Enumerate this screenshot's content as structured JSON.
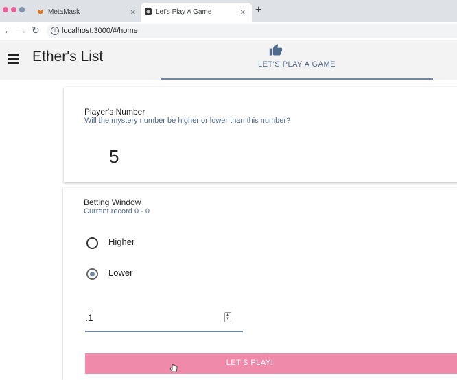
{
  "browser": {
    "tabs": [
      {
        "title": "MetaMask",
        "active": false
      },
      {
        "title": "Let's Play A Game",
        "active": true
      }
    ],
    "address": "localhost:3000/#/home"
  },
  "app": {
    "title": "Ether's List",
    "nav_tab": {
      "label": "LET'S PLAY A GAME",
      "icon": "thumbs-up-icon"
    }
  },
  "players_card": {
    "title": "Player's Number",
    "subtitle": "Will the mystery number be higher or lower than this number?",
    "number": "5"
  },
  "betting_card": {
    "title": "Betting Window",
    "subtitle": "Current record 0 - 0",
    "options": [
      {
        "label": "Higher",
        "selected": false
      },
      {
        "label": "Lower",
        "selected": true
      }
    ],
    "bet_value": ".1",
    "play_label": "LET'S PLAY!"
  },
  "colors": {
    "accent": "#6d86a6",
    "play_button": "#f08aaa",
    "appbar": "#f3f3f3"
  }
}
